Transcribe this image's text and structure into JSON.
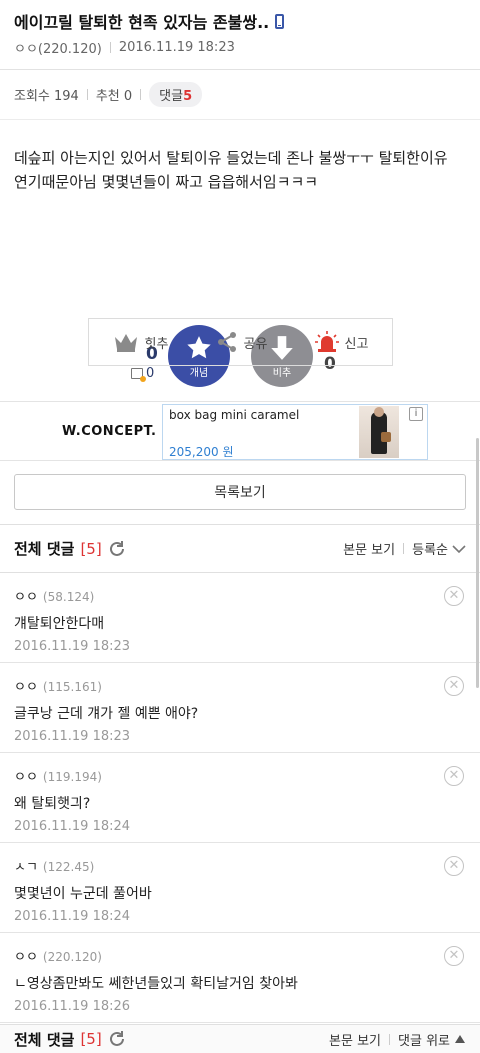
{
  "post": {
    "title": "에이끄릴 탈퇴한 현족 있자늠 존불쌍..",
    "author": "ㅇㅇ(220.120)",
    "date": "2016.11.19 18:23",
    "views_label": "조회수 194",
    "recommend_label": "추천 0",
    "comments_label": "댓글",
    "comments_count": "5",
    "body_line1": "데슾피 아는지인 있어서 탈퇴이유 들었는데 존나 불쌍ㅜㅜ 탈퇴한이유",
    "body_line2": "연기때문아님 몇몇년들이 짜고 읍읍해서임ㅋㅋㅋ"
  },
  "vote": {
    "up_count": "0",
    "up_sub_count": "0",
    "up_label": "개념",
    "down_label": "비추",
    "down_count": "0"
  },
  "actions": {
    "hit_label": "힛추",
    "share_label": "공유",
    "report_label": "신고"
  },
  "ad": {
    "brand": "W.CONCEPT.",
    "product": "box bag mini caramel",
    "price": "205,200 원",
    "info": "i"
  },
  "list_button": "목록보기",
  "comments_header": {
    "title": "전체 댓글",
    "count": "[5]",
    "view_body": "본문 보기",
    "sort": "등록순"
  },
  "comments_footer": {
    "title": "전체 댓글",
    "count": "[5]",
    "view_body": "본문 보기",
    "to_top": "댓글 위로"
  },
  "comments": [
    {
      "author": "ㅇㅇ",
      "ip": "(58.124)",
      "text": "걔탈퇴안한다매",
      "date": "2016.11.19 18:23"
    },
    {
      "author": "ㅇㅇ",
      "ip": "(115.161)",
      "text": "글쿠낭 근데 걔가 젤 예쁜 애야?",
      "date": "2016.11.19 18:23"
    },
    {
      "author": "ㅇㅇ",
      "ip": "(119.194)",
      "text": "왜 탈퇴햇긔?",
      "date": "2016.11.19 18:24"
    },
    {
      "author": "ㅅㄱ",
      "ip": "(122.45)",
      "text": "몇몇년이 누군데 풀어바",
      "date": "2016.11.19 18:24"
    },
    {
      "author": "ㅇㅇ",
      "ip": "(220.120)",
      "text": "ㄴ영상좀만봐도 쎄한년들있긔 확티날거임 찾아봐",
      "date": "2016.11.19 18:26"
    }
  ],
  "colors": {
    "accent": "#3b4ea6",
    "downvote": "#8e8e93",
    "count_red": "#d33333",
    "price_blue": "#2f7fd1"
  },
  "icons": {
    "title_icon": "mobile-phone-icon",
    "up_icon": "star-icon",
    "down_icon": "down-arrow-icon",
    "hit_icon": "crown-icon",
    "share_icon": "share-icon",
    "report_icon": "siren-icon",
    "refresh_icon": "refresh-icon",
    "sort_icon": "chevron-down-icon",
    "to_top_icon": "triangle-up-icon",
    "delete_icon": "close-circle-icon"
  }
}
